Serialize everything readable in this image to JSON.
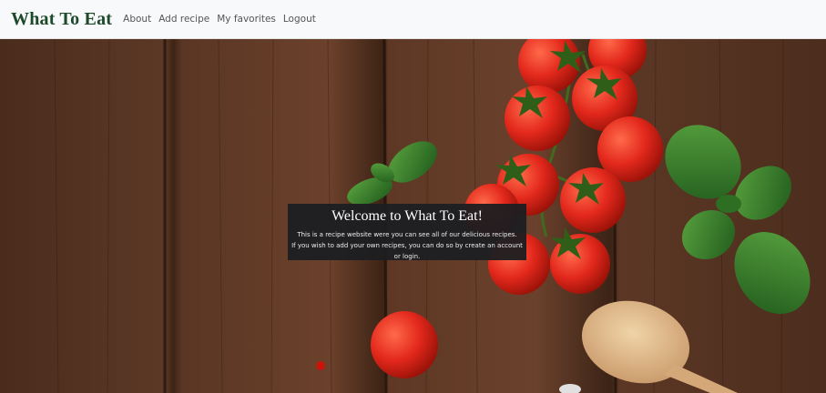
{
  "navbar": {
    "brand": "What To Eat",
    "links": [
      "About",
      "Add recipe",
      "My favorites",
      "Logout"
    ]
  },
  "hero": {
    "title": "Welcome to What To Eat!",
    "line1": "This is a recipe website were you can see all of our delicious recipes.",
    "line2": "If you wish to add your own recipes, you can do so by create an account or login."
  },
  "colors": {
    "brand": "#1d4a2a",
    "navbar_bg": "#f8f9fa",
    "welcome_bg": "#1c1e21",
    "tomato": "#e3281c",
    "basil": "#2f7a2a"
  },
  "image": {
    "icon": "food-background-image"
  }
}
